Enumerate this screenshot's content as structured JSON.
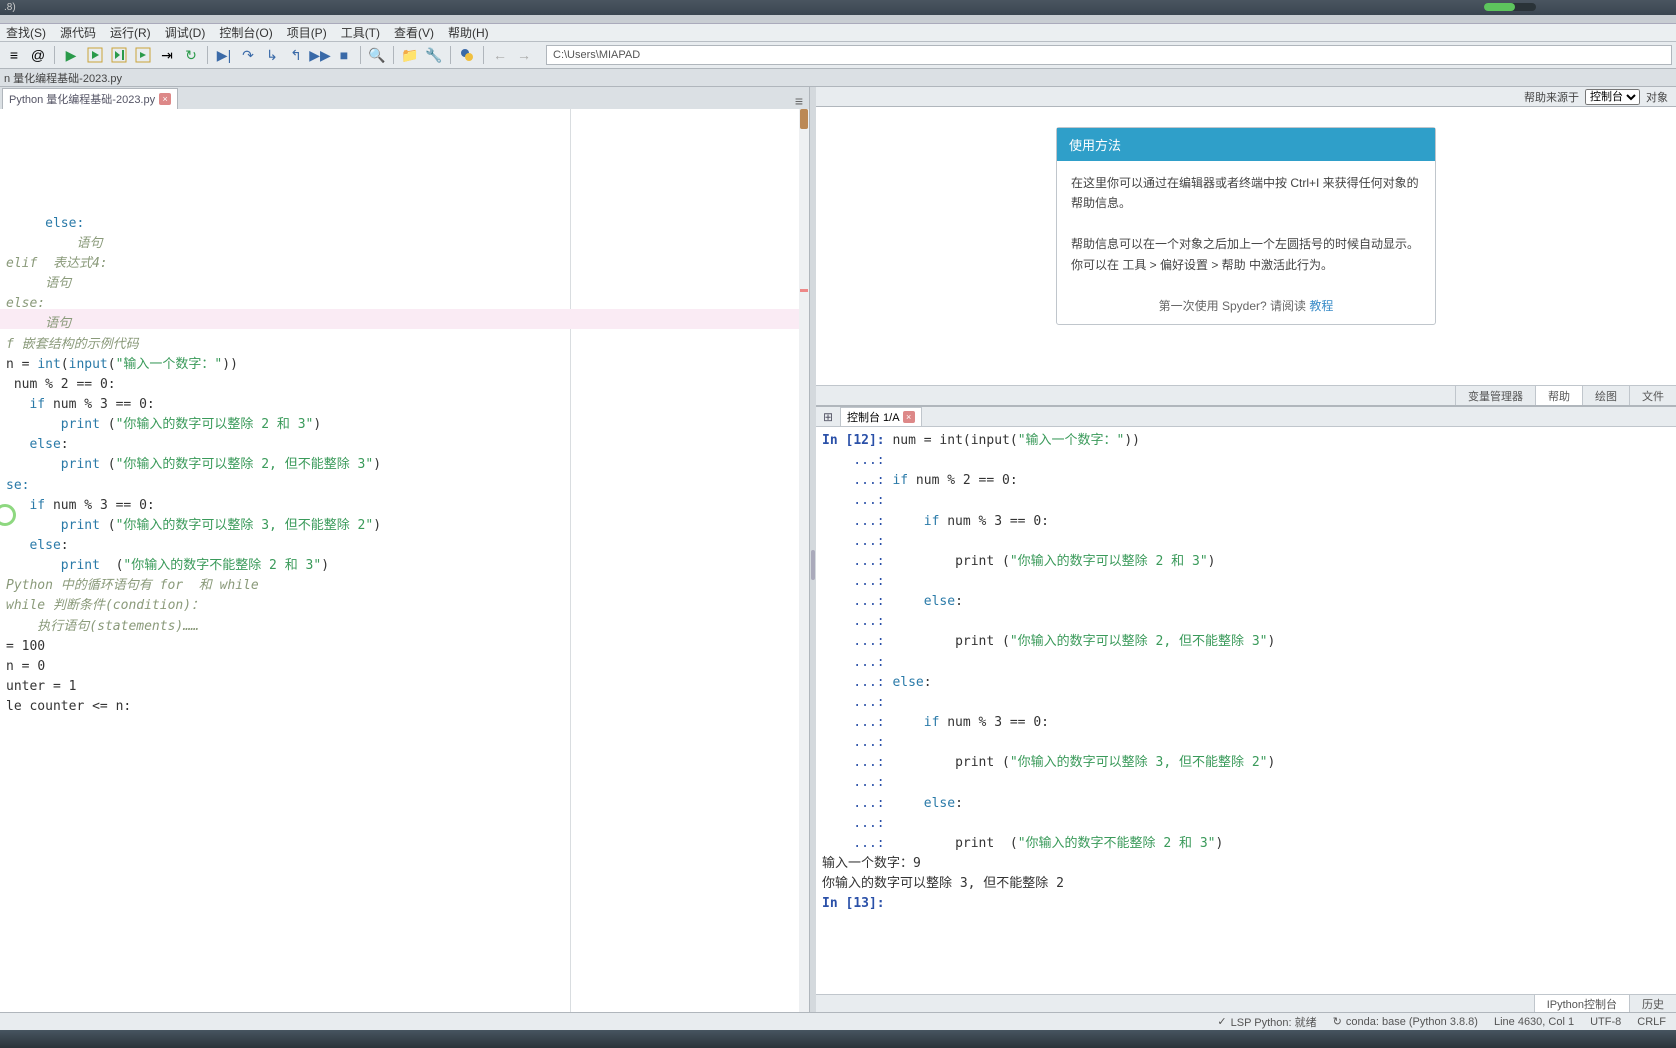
{
  "titlebar": {
    "version": ".8)"
  },
  "menu": [
    "查找(S)",
    "源代码",
    "运行(R)",
    "调试(D)",
    "控制台(O)",
    "项目(P)",
    "工具(T)",
    "查看(V)",
    "帮助(H)"
  ],
  "path": "C:\\Users\\MIAPAD",
  "breadcrumb": "n 量化编程基础-2023.py",
  "filetab": "Python 量化编程基础-2023.py",
  "editor_lines": [
    {
      "t": "     else:",
      "cls": "kw"
    },
    {
      "t": "         语句",
      "cls": "cm"
    },
    {
      "t": "elif  表达式4:",
      "cls": "cm"
    },
    {
      "t": "     语句",
      "cls": "cm"
    },
    {
      "t": "else:",
      "cls": "cm"
    },
    {
      "t": "     语句",
      "cls": "cm"
    },
    {
      "t": ""
    },
    {
      "t": ""
    },
    {
      "t": "f 嵌套结构的示例代码",
      "cls": "cm"
    },
    {
      "t": ""
    },
    {
      "fragments": [
        {
          "t": "n = ",
          "cls": "op"
        },
        {
          "t": "int",
          "cls": "kw"
        },
        {
          "t": "(",
          "cls": "op"
        },
        {
          "t": "input",
          "cls": "kw"
        },
        {
          "t": "(",
          "cls": "op"
        },
        {
          "t": "\"输入一个数字：\"",
          "cls": "str"
        },
        {
          "t": "))",
          "cls": "op"
        }
      ],
      "hl": true
    },
    {
      "t": ""
    },
    {
      "fragments": [
        {
          "t": " num % ",
          "cls": "op"
        },
        {
          "t": "2",
          "cls": "num"
        },
        {
          "t": " == ",
          "cls": "op"
        },
        {
          "t": "0",
          "cls": "num"
        },
        {
          "t": ":",
          "cls": "op"
        }
      ]
    },
    {
      "t": ""
    },
    {
      "fragments": [
        {
          "t": "   if",
          "cls": "kw"
        },
        {
          "t": " num % ",
          "cls": "op"
        },
        {
          "t": "3",
          "cls": "num"
        },
        {
          "t": " == ",
          "cls": "op"
        },
        {
          "t": "0",
          "cls": "num"
        },
        {
          "t": ":",
          "cls": "op"
        }
      ]
    },
    {
      "t": ""
    },
    {
      "fragments": [
        {
          "t": "       print",
          "cls": "kw"
        },
        {
          "t": " (",
          "cls": "op"
        },
        {
          "t": "\"你输入的数字可以整除 2 和 3\"",
          "cls": "str"
        },
        {
          "t": ")",
          "cls": "op"
        }
      ]
    },
    {
      "t": ""
    },
    {
      "fragments": [
        {
          "t": "   else",
          "cls": "kw"
        },
        {
          "t": ":",
          "cls": "op"
        }
      ]
    },
    {
      "t": ""
    },
    {
      "fragments": [
        {
          "t": "       print",
          "cls": "kw"
        },
        {
          "t": " (",
          "cls": "op"
        },
        {
          "t": "\"你输入的数字可以整除 2, 但不能整除 3\"",
          "cls": "str"
        },
        {
          "t": ")",
          "cls": "op"
        }
      ]
    },
    {
      "t": ""
    },
    {
      "fragments": [
        {
          "t": "se:",
          "cls": "kw"
        }
      ]
    },
    {
      "t": ""
    },
    {
      "fragments": [
        {
          "t": "   if",
          "cls": "kw"
        },
        {
          "t": " num % ",
          "cls": "op"
        },
        {
          "t": "3",
          "cls": "num"
        },
        {
          "t": " == ",
          "cls": "op"
        },
        {
          "t": "0",
          "cls": "num"
        },
        {
          "t": ":",
          "cls": "op"
        }
      ]
    },
    {
      "t": ""
    },
    {
      "fragments": [
        {
          "t": "       print",
          "cls": "kw"
        },
        {
          "t": " (",
          "cls": "op"
        },
        {
          "t": "\"你输入的数字可以整除 3, 但不能整除 2\"",
          "cls": "str"
        },
        {
          "t": ")",
          "cls": "op"
        }
      ]
    },
    {
      "t": ""
    },
    {
      "fragments": [
        {
          "t": "   else",
          "cls": "kw"
        },
        {
          "t": ":",
          "cls": "op"
        }
      ]
    },
    {
      "t": ""
    },
    {
      "fragments": [
        {
          "t": "       print",
          "cls": "kw"
        },
        {
          "t": "  (",
          "cls": "op"
        },
        {
          "t": "\"你输入的数字不能整除 2 和 3\"",
          "cls": "str"
        },
        {
          "t": ")",
          "cls": "op"
        }
      ]
    },
    {
      "t": ""
    },
    {
      "t": ""
    },
    {
      "t": ""
    },
    {
      "t": "Python 中的循环语句有 for  和 while",
      "cls": "cm"
    },
    {
      "t": ""
    },
    {
      "t": "while 判断条件(condition)：",
      "cls": "cm"
    },
    {
      "t": ""
    },
    {
      "t": "    执行语句(statements)……",
      "cls": "cm"
    },
    {
      "t": ""
    },
    {
      "fragments": [
        {
          "t": "= ",
          "cls": "op"
        },
        {
          "t": "100",
          "cls": "num"
        }
      ]
    },
    {
      "fragments": [
        {
          "t": "n = ",
          "cls": "op"
        },
        {
          "t": "0",
          "cls": "num"
        }
      ]
    },
    {
      "fragments": [
        {
          "t": "unter = ",
          "cls": "op"
        },
        {
          "t": "1",
          "cls": "num"
        }
      ]
    },
    {
      "t": ""
    },
    {
      "fragments": [
        {
          "t": "le counter <= n:",
          "cls": "op"
        }
      ]
    }
  ],
  "help": {
    "source_label": "帮助来源于",
    "source_sel": "控制台",
    "obj_label": "对象",
    "title": "使用方法",
    "body1": "在这里你可以通过在编辑器或者终端中按 Ctrl+I 来获得任何对象的帮助信息。",
    "body2": "帮助信息可以在一个对象之后加上一个左圆括号的时候自动显示。 你可以在 工具 > 偏好设置 > 帮助 中激活此行为。",
    "foot_pre": "第一次使用 Spyder? 请阅读 ",
    "foot_link": "教程",
    "tabs": [
      "变量管理器",
      "帮助",
      "绘图",
      "文件"
    ]
  },
  "console": {
    "tab": "控制台 1/A",
    "lines": [
      {
        "fragments": [
          {
            "t": "In [",
            "cls": "prompt"
          },
          {
            "t": "12",
            "cls": "prompt"
          },
          {
            "t": "]: ",
            "cls": "prompt"
          },
          {
            "t": "num = int(input(",
            "cls": "op"
          },
          {
            "t": "\"输入一个数字：\"",
            "cls": "cstr"
          },
          {
            "t": "))",
            "cls": "op"
          }
        ]
      },
      {
        "fragments": [
          {
            "t": "    ...: ",
            "cls": "dots"
          }
        ]
      },
      {
        "fragments": [
          {
            "t": "    ...: ",
            "cls": "dots"
          },
          {
            "t": "if",
            "cls": "kw"
          },
          {
            "t": " num % ",
            "cls": "op"
          },
          {
            "t": "2",
            "cls": "num"
          },
          {
            "t": " == ",
            "cls": "op"
          },
          {
            "t": "0",
            "cls": "num"
          },
          {
            "t": ":",
            "cls": "op"
          }
        ]
      },
      {
        "fragments": [
          {
            "t": "    ...: ",
            "cls": "dots"
          }
        ]
      },
      {
        "fragments": [
          {
            "t": "    ...:     ",
            "cls": "dots"
          },
          {
            "t": "if",
            "cls": "kw"
          },
          {
            "t": " num % ",
            "cls": "op"
          },
          {
            "t": "3",
            "cls": "num"
          },
          {
            "t": " == ",
            "cls": "op"
          },
          {
            "t": "0",
            "cls": "num"
          },
          {
            "t": ":",
            "cls": "op"
          }
        ]
      },
      {
        "fragments": [
          {
            "t": "    ...: ",
            "cls": "dots"
          }
        ]
      },
      {
        "fragments": [
          {
            "t": "    ...:         ",
            "cls": "dots"
          },
          {
            "t": "print (",
            "cls": "op"
          },
          {
            "t": "\"你输入的数字可以整除 2 和 3\"",
            "cls": "cstr"
          },
          {
            "t": ")",
            "cls": "op"
          }
        ]
      },
      {
        "fragments": [
          {
            "t": "    ...: ",
            "cls": "dots"
          }
        ]
      },
      {
        "fragments": [
          {
            "t": "    ...:     ",
            "cls": "dots"
          },
          {
            "t": "else",
            "cls": "kw"
          },
          {
            "t": ":",
            "cls": "op"
          }
        ]
      },
      {
        "fragments": [
          {
            "t": "    ...: ",
            "cls": "dots"
          }
        ]
      },
      {
        "fragments": [
          {
            "t": "    ...:         ",
            "cls": "dots"
          },
          {
            "t": "print (",
            "cls": "op"
          },
          {
            "t": "\"你输入的数字可以整除 2, 但不能整除 3\"",
            "cls": "cstr"
          },
          {
            "t": ")",
            "cls": "op"
          }
        ]
      },
      {
        "fragments": [
          {
            "t": "    ...: ",
            "cls": "dots"
          }
        ]
      },
      {
        "fragments": [
          {
            "t": "    ...: ",
            "cls": "dots"
          },
          {
            "t": "else",
            "cls": "kw"
          },
          {
            "t": ":",
            "cls": "op"
          }
        ]
      },
      {
        "fragments": [
          {
            "t": "    ...: ",
            "cls": "dots"
          }
        ]
      },
      {
        "fragments": [
          {
            "t": "    ...:     ",
            "cls": "dots"
          },
          {
            "t": "if",
            "cls": "kw"
          },
          {
            "t": " num % ",
            "cls": "op"
          },
          {
            "t": "3",
            "cls": "num"
          },
          {
            "t": " == ",
            "cls": "op"
          },
          {
            "t": "0",
            "cls": "num"
          },
          {
            "t": ":",
            "cls": "op"
          }
        ]
      },
      {
        "fragments": [
          {
            "t": "    ...: ",
            "cls": "dots"
          }
        ]
      },
      {
        "fragments": [
          {
            "t": "    ...:         ",
            "cls": "dots"
          },
          {
            "t": "print (",
            "cls": "op"
          },
          {
            "t": "\"你输入的数字可以整除 3, 但不能整除 2\"",
            "cls": "cstr"
          },
          {
            "t": ")",
            "cls": "op"
          }
        ]
      },
      {
        "fragments": [
          {
            "t": "    ...: ",
            "cls": "dots"
          }
        ]
      },
      {
        "fragments": [
          {
            "t": "    ...:     ",
            "cls": "dots"
          },
          {
            "t": "else",
            "cls": "kw"
          },
          {
            "t": ":",
            "cls": "op"
          }
        ]
      },
      {
        "fragments": [
          {
            "t": "    ...: ",
            "cls": "dots"
          }
        ]
      },
      {
        "fragments": [
          {
            "t": "    ...:         ",
            "cls": "dots"
          },
          {
            "t": "print  (",
            "cls": "op"
          },
          {
            "t": "\"你输入的数字不能整除 2 和 3\"",
            "cls": "cstr"
          },
          {
            "t": ")",
            "cls": "op"
          }
        ]
      },
      {
        "t": ""
      },
      {
        "t": "输入一个数字：9"
      },
      {
        "t": "你输入的数字可以整除 3, 但不能整除 2"
      },
      {
        "t": ""
      },
      {
        "fragments": [
          {
            "t": "In [",
            "cls": "prompt"
          },
          {
            "t": "13",
            "cls": "prompt"
          },
          {
            "t": "]: ",
            "cls": "prompt"
          }
        ]
      }
    ],
    "btabs": [
      "IPython控制台",
      "历史"
    ]
  },
  "status": {
    "lsp": "LSP Python: 就绪",
    "conda": "conda: base (Python 3.8.8)",
    "pos": "Line 4630, Col 1",
    "enc": "UTF-8",
    "eol": "CRLF"
  }
}
